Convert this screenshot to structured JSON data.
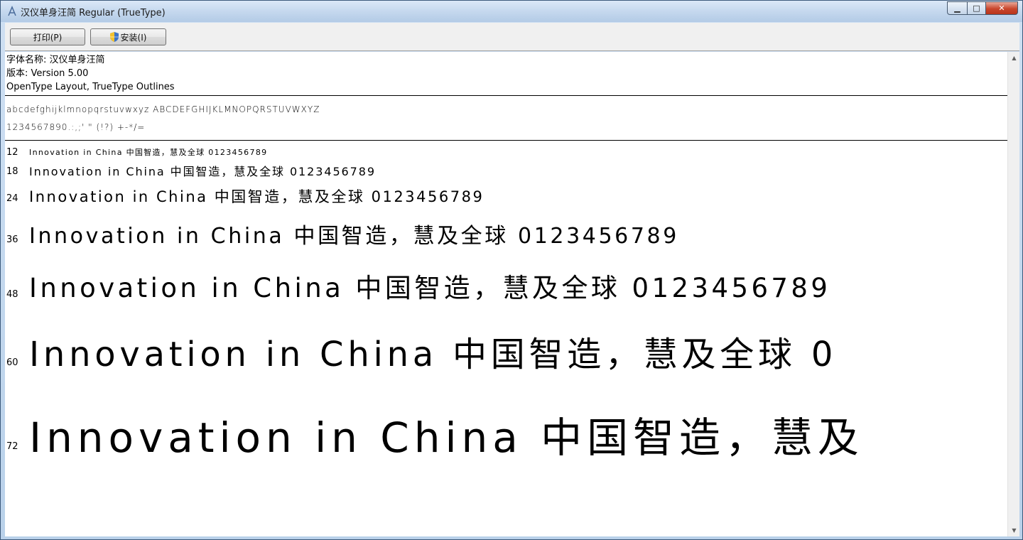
{
  "window": {
    "title": "汉仪单身汪简 Regular (TrueType)",
    "controls": {
      "minimize": "▁",
      "maximize": "□",
      "close": "✕"
    }
  },
  "toolbar": {
    "print_label": "打印(P)",
    "install_label": "安装(I)"
  },
  "font_info": {
    "name_line": "字体名称: 汉仪单身汪简",
    "version_line": "版本: Version 5.00",
    "format_line": "OpenType Layout, TrueType Outlines"
  },
  "charset": {
    "line1": "abcdefghijklmnopqrstuvwxyz ABCDEFGHIJKLMNOPQRSTUVWXYZ",
    "line2": "1234567890.:,;' \" (!?) +-*/="
  },
  "samples": [
    {
      "size": "12",
      "text": "Innovation in China 中国智造，慧及全球 0123456789"
    },
    {
      "size": "18",
      "text": "Innovation in China 中国智造，慧及全球 0123456789"
    },
    {
      "size": "24",
      "text": "Innovation in China 中国智造，慧及全球 0123456789"
    },
    {
      "size": "36",
      "text": "Innovation in China 中国智造，慧及全球 0123456789"
    },
    {
      "size": "48",
      "text": "Innovation in China 中国智造，慧及全球 0123456789"
    },
    {
      "size": "60",
      "text": "Innovation in China 中国智造，慧及全球 0"
    },
    {
      "size": "72",
      "text": "Innovation in China 中国智造，慧及"
    }
  ],
  "icons": {
    "app": "font-file-icon",
    "install": "uac-shield-icon",
    "scroll_up": "scroll-up-arrow-icon",
    "scroll_down": "scroll-down-arrow-icon"
  }
}
